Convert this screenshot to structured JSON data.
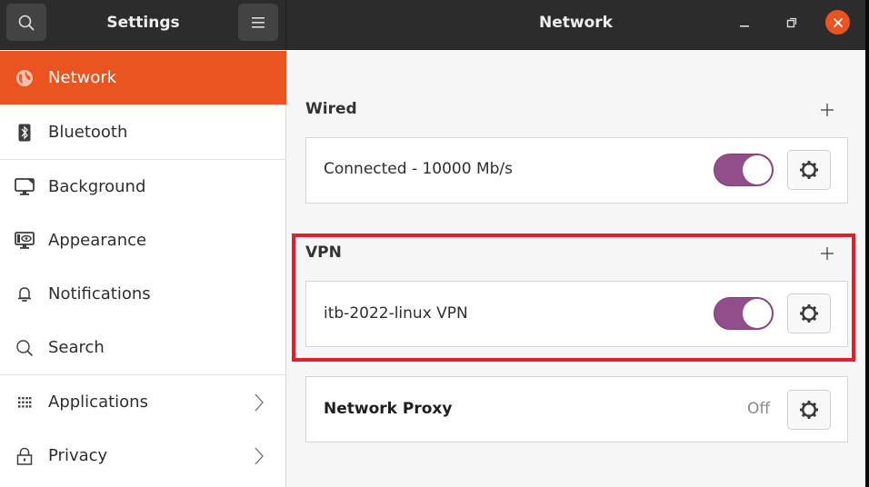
{
  "headerbar": {
    "left_title": "Settings",
    "right_title": "Network",
    "search_icon": "search-icon",
    "menu_icon": "hamburger-menu-icon",
    "window_controls": [
      "minimize",
      "restore",
      "close"
    ]
  },
  "sidebar": {
    "items": [
      {
        "label": "Network",
        "icon": "globe-icon",
        "active": true
      },
      {
        "label": "Bluetooth",
        "icon": "bluetooth-icon"
      },
      {
        "label": "Background",
        "icon": "monitor-wallpaper-icon"
      },
      {
        "label": "Appearance",
        "icon": "appearance-icon"
      },
      {
        "label": "Notifications",
        "icon": "bell-icon"
      },
      {
        "label": "Search",
        "icon": "search-icon"
      },
      {
        "label": "Applications",
        "icon": "apps-grid-icon",
        "has_submenu": true
      },
      {
        "label": "Privacy",
        "icon": "lock-icon",
        "has_submenu": true
      }
    ]
  },
  "main": {
    "wired": {
      "title": "Wired",
      "connection": {
        "label": "Connected - 10000 Mb/s",
        "enabled": true
      }
    },
    "vpn": {
      "title": "VPN",
      "connection": {
        "label": "itb-2022-linux VPN",
        "enabled": true
      }
    },
    "proxy": {
      "label": "Network Proxy",
      "status": "Off"
    }
  },
  "colors": {
    "accent": "#e95420",
    "toggle_on": "#924d8b",
    "highlight": "#e0202c"
  }
}
